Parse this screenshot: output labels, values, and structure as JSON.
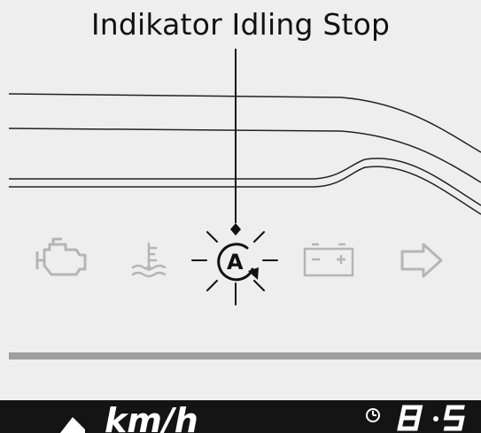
{
  "callout": {
    "label": "Indikator Idling Stop"
  },
  "indicators": [
    {
      "icon": "check-engine-icon"
    },
    {
      "icon": "coolant-temperature-icon"
    },
    {
      "icon": "idling-stop-icon",
      "active": true
    },
    {
      "icon": "battery-charge-icon"
    },
    {
      "icon": "turn-signal-right-icon"
    }
  ],
  "bottom_display": {
    "speed_unit": "km/h",
    "clock_icon": "clock-icon",
    "digits": "8:5"
  },
  "colors": {
    "background": "#eeeeee",
    "panel_line": "#222222",
    "indicator_inactive": "#b5b5b5",
    "indicator_active": "#111111",
    "separator": "#9e9e9e",
    "display_background": "#141414",
    "display_text": "#ffffff"
  }
}
